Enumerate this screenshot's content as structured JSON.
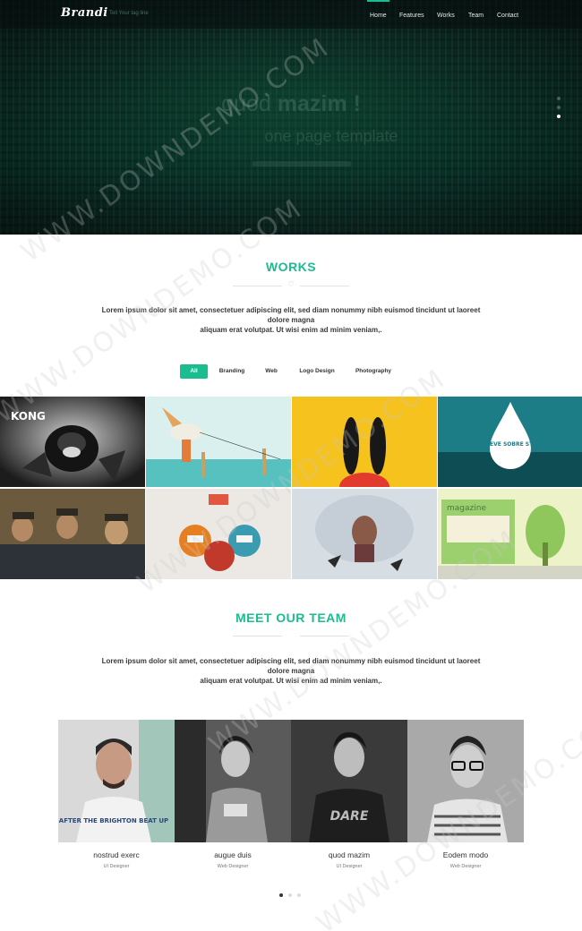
{
  "header": {
    "brand": "Brandi",
    "tagline": "Tell Your tag line",
    "nav": [
      "Home",
      "Features",
      "Works",
      "Team",
      "Contact"
    ],
    "active_nav": "Home"
  },
  "hero": {
    "title_light": "quod ",
    "title_bold": "mazim !",
    "subtitle": "one page template",
    "slides_total": 3,
    "active_slide": 3
  },
  "watermark": "WWW.DOWNDEMO.COM",
  "works": {
    "title": "WORKS",
    "divider_icon": "heart-icon",
    "text_line1": "Lorem ipsum dolor sit amet, consectetuer adipiscing elit, sed diam nonummy nibh euismod tincidunt ut laoreet",
    "text_line2": "dolore magna",
    "text_line3": "aliquam erat volutpat. Ut wisi enim ad minim veniam,.",
    "filters": [
      "All",
      "Branding",
      "Web",
      "Logo Design",
      "Photography"
    ],
    "active_filter": "All",
    "tiles": [
      {
        "caption": "KONG"
      },
      {
        "caption": ""
      },
      {
        "caption": ""
      },
      {
        "caption": "LLUEVE SOBRE STGO"
      },
      {
        "caption": ""
      },
      {
        "caption": ""
      },
      {
        "caption": ""
      },
      {
        "caption": "magazine"
      }
    ]
  },
  "team": {
    "title": "MEET OUR TEAM",
    "text_line1": "Lorem ipsum dolor sit amet, consectetuer adipiscing elit, sed diam nonummy nibh euismod tincidunt ut laoreet",
    "text_line2": "dolore magna",
    "text_line3": "aliquam erat volutpat. Ut wisi enim ad minim veniam,.",
    "members": [
      {
        "name": "nostrud exerc",
        "role": "UI Designer",
        "shirt_text": "AFTER THE BRIGHTON BEAT UP"
      },
      {
        "name": "augue duis",
        "role": "Web Designer",
        "shirt_text": ""
      },
      {
        "name": "quod mazim",
        "role": "UI Designer",
        "shirt_text": "DARE"
      },
      {
        "name": "Eodem modo",
        "role": "Web Designer",
        "shirt_text": ""
      }
    ],
    "pages_total": 3,
    "active_page": 1
  },
  "colors": {
    "accent": "#1bbc8f",
    "hero_bg": "#0b2a22",
    "text": "#333333"
  }
}
